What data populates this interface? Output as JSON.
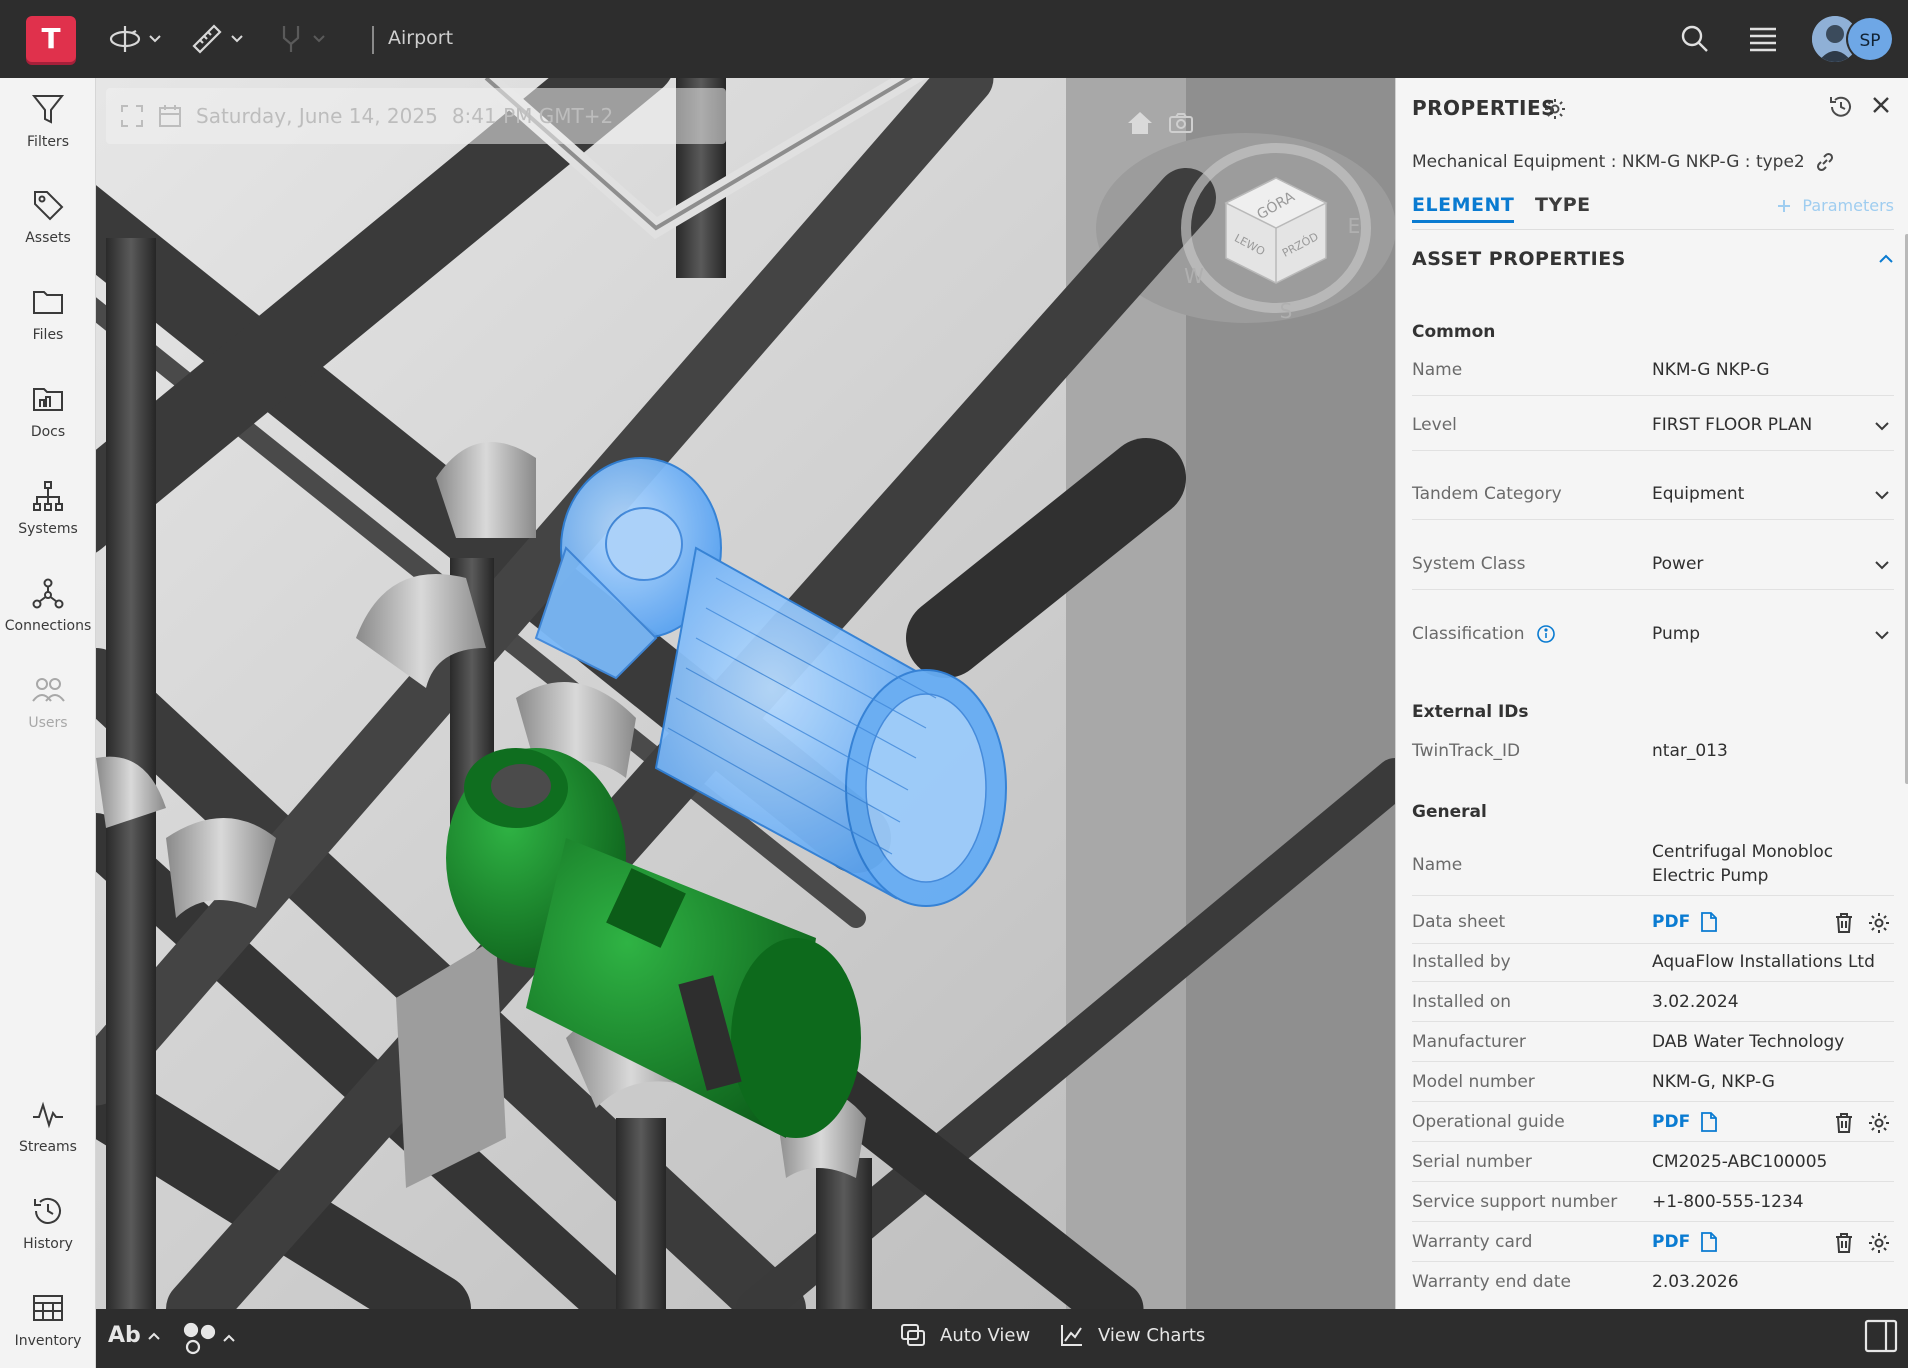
{
  "app": {
    "logo_letter": "T",
    "project": "Airport"
  },
  "user": {
    "initials": "SP"
  },
  "rail": [
    {
      "label": "Filters",
      "icon": "filter-icon"
    },
    {
      "label": "Assets",
      "icon": "tag-icon"
    },
    {
      "label": "Files",
      "icon": "folder-icon"
    },
    {
      "label": "Docs",
      "icon": "docs-icon"
    },
    {
      "label": "Systems",
      "icon": "hierarchy-icon"
    },
    {
      "label": "Connections",
      "icon": "connections-icon"
    },
    {
      "label": "Users",
      "icon": "users-icon"
    },
    {
      "label": "Streams",
      "icon": "pulse-icon"
    },
    {
      "label": "History",
      "icon": "history-icon"
    },
    {
      "label": "Inventory",
      "icon": "table-icon"
    }
  ],
  "viewport": {
    "date": "Saturday, June 14, 2025",
    "time": "8:41 PM GMT+2",
    "viewcube": {
      "top": "GÓRA",
      "left": "LEWO",
      "front": "PRZÓD",
      "east": "E",
      "west": "W",
      "south": "S"
    }
  },
  "bottombar": {
    "text_toggle": "Ab",
    "auto_view": "Auto View",
    "view_charts": "View Charts"
  },
  "panel": {
    "title": "PROPERTIES",
    "subtitle": "Mechanical Equipment : NKM-G NKP-G : type2",
    "tabs": {
      "element": "ELEMENT",
      "type": "TYPE"
    },
    "parameters_link": "Parameters",
    "section": "ASSET PROPERTIES",
    "groups": {
      "common": "Common",
      "external": "External IDs",
      "general": "General"
    },
    "common_rows": {
      "name": {
        "k": "Name",
        "v": "NKM-G NKP-G"
      },
      "level": {
        "k": "Level",
        "v": "FIRST FLOOR PLAN"
      },
      "category": {
        "k": "Tandem Category",
        "v": "Equipment"
      },
      "system_class": {
        "k": "System Class",
        "v": "Power"
      },
      "classification": {
        "k": "Classification",
        "v": "Pump"
      }
    },
    "external_rows": {
      "twintrack": {
        "k": "TwinTrack_ID",
        "v": "ntar_013"
      }
    },
    "general_rows": {
      "name": {
        "k": "Name",
        "v1": "Centrifugal Monobloc",
        "v2": "Electric Pump"
      },
      "data_sheet": {
        "k": "Data sheet",
        "v": "PDF"
      },
      "installed_by": {
        "k": "Installed by",
        "v": "AquaFlow Installations Ltd"
      },
      "installed_on": {
        "k": "Installed on",
        "v": "3.02.2024"
      },
      "manufacturer": {
        "k": "Manufacturer",
        "v": "DAB Water Technology"
      },
      "model_number": {
        "k": "Model number",
        "v": "NKM-G, NKP-G"
      },
      "operational_guide": {
        "k": "Operational guide",
        "v": "PDF"
      },
      "serial_number": {
        "k": "Serial number",
        "v": "CM2025-ABC100005"
      },
      "service_support": {
        "k": "Service support number",
        "v": "+1-800-555-1234"
      },
      "warranty_card": {
        "k": "Warranty card",
        "v": "PDF"
      },
      "warranty_end": {
        "k": "Warranty end date",
        "v": "2.03.2026"
      }
    }
  },
  "colors": {
    "accent": "#0a7bd1",
    "logo": "#e0314c",
    "selection": "#5ea8f5",
    "pump_green": "#1e8a2e"
  }
}
